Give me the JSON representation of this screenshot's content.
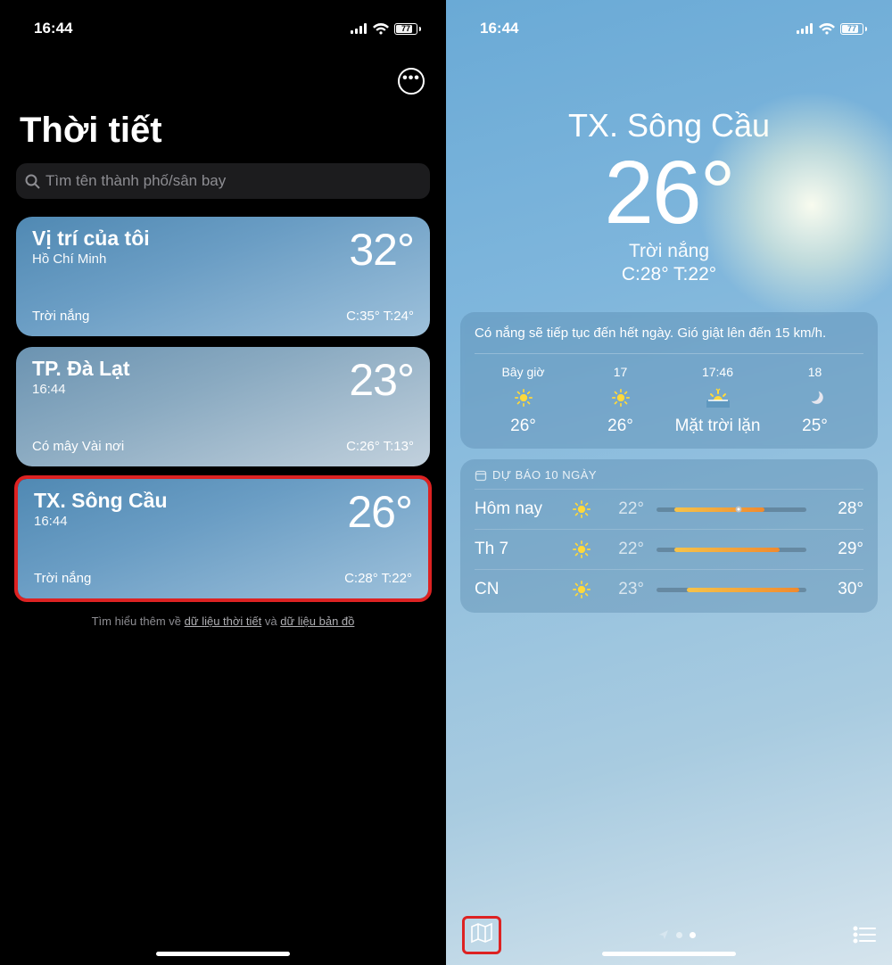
{
  "status": {
    "time": "16:44",
    "battery": "77"
  },
  "left": {
    "title": "Thời tiết",
    "search_placeholder": "Tìm tên thành phố/sân bay",
    "cities": [
      {
        "name": "Vị trí của tôi",
        "sub": "Hồ Chí Minh",
        "temp": "32°",
        "cond": "Trời nắng",
        "hilo": "C:35°  T:24°"
      },
      {
        "name": "TP. Đà Lạt",
        "sub": "16:44",
        "temp": "23°",
        "cond": "Có mây Vài nơi",
        "hilo": "C:26°  T:13°"
      },
      {
        "name": "TX. Sông Cầu",
        "sub": "16:44",
        "temp": "26°",
        "cond": "Trời nắng",
        "hilo": "C:28°  T:22°"
      }
    ],
    "footer_pre": "Tìm hiểu thêm về ",
    "footer_link1": "dữ liệu thời tiết",
    "footer_and": " và ",
    "footer_link2": "dữ liệu bản đồ"
  },
  "right": {
    "location": "TX. Sông Cầu",
    "temp": "26°",
    "cond": "Trời nắng",
    "hilo": "C:28°  T:22°",
    "summary": "Có nắng sẽ tiếp tục đến hết ngày. Gió giật lên đến 15 km/h.",
    "hourly": [
      {
        "t": "Bây giờ",
        "v": "26°",
        "icon": "sun"
      },
      {
        "t": "17",
        "v": "26°",
        "icon": "sun"
      },
      {
        "t": "17:46",
        "v": "Mặt trời lặn",
        "icon": "sunset"
      },
      {
        "t": "18",
        "v": "25°",
        "icon": "moon"
      }
    ],
    "daily_title": "DỰ BÁO 10 NGÀY",
    "daily": [
      {
        "d": "Hôm nay",
        "lo": "22°",
        "hi": "28°",
        "bl": 12,
        "bw": 60,
        "dot": 55
      },
      {
        "d": "Th 7",
        "lo": "22°",
        "hi": "29°",
        "bl": 12,
        "bw": 70,
        "dot": null
      },
      {
        "d": "CN",
        "lo": "23°",
        "hi": "30°",
        "bl": 20,
        "bw": 75,
        "dot": null
      }
    ]
  }
}
